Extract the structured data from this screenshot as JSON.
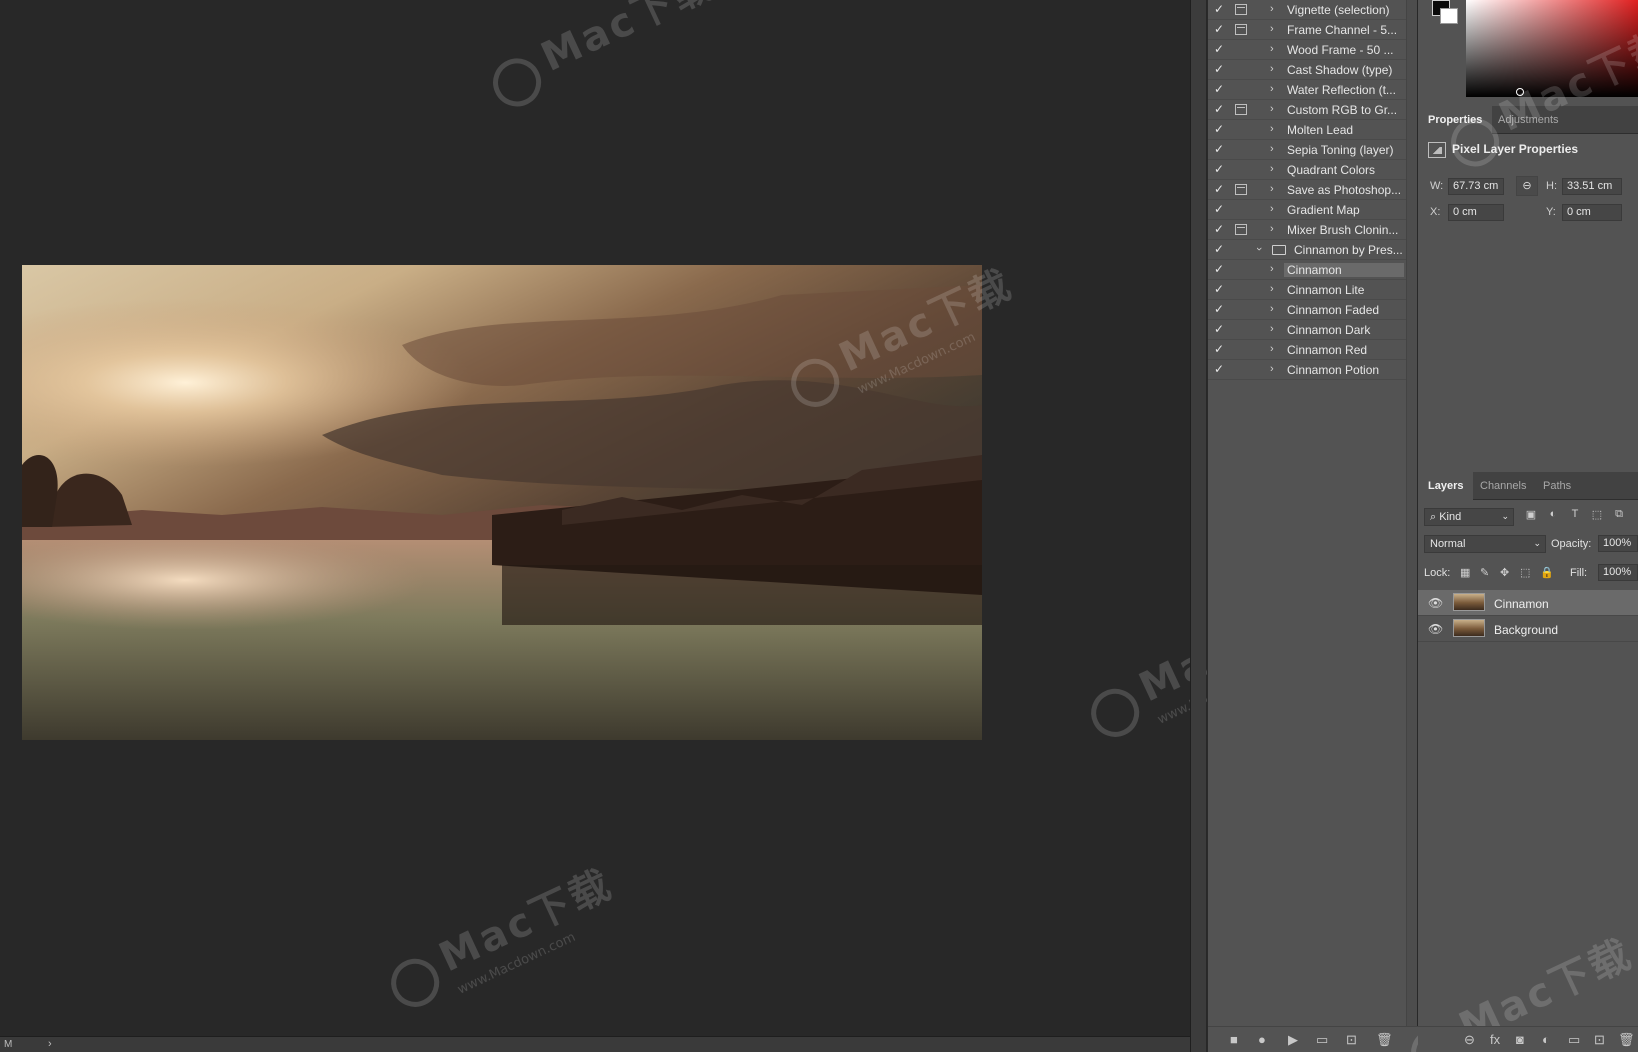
{
  "actions": [
    {
      "label": "Vignette (selection)",
      "dialog": true
    },
    {
      "label": "Frame Channel - 5...",
      "dialog": true
    },
    {
      "label": "Wood Frame - 50 ...",
      "dialog": false
    },
    {
      "label": "Cast Shadow (type)",
      "dialog": false
    },
    {
      "label": "Water Reflection (t...",
      "dialog": false
    },
    {
      "label": "Custom RGB to Gr...",
      "dialog": true
    },
    {
      "label": "Molten Lead",
      "dialog": false
    },
    {
      "label": "Sepia Toning (layer)",
      "dialog": false
    },
    {
      "label": "Quadrant Colors",
      "dialog": false
    },
    {
      "label": "Save as Photoshop...",
      "dialog": true
    },
    {
      "label": "Gradient Map",
      "dialog": false
    },
    {
      "label": "Mixer Brush Clonin...",
      "dialog": true
    }
  ],
  "action_set": {
    "label": "Cinnamon by Pres..."
  },
  "set_actions": [
    {
      "label": "Cinnamon",
      "selected": true
    },
    {
      "label": "Cinnamon Lite",
      "selected": false
    },
    {
      "label": "Cinnamon Faded",
      "selected": false
    },
    {
      "label": "Cinnamon Dark",
      "selected": false
    },
    {
      "label": "Cinnamon Red",
      "selected": false
    },
    {
      "label": "Cinnamon Potion",
      "selected": false
    }
  ],
  "check_glyph": "✓",
  "properties": {
    "tab_properties": "Properties",
    "tab_adjustments": "Adjustments",
    "title": "Pixel Layer Properties",
    "w_label": "W:",
    "w_value": "67.73 cm",
    "h_label": "H:",
    "h_value": "33.51 cm",
    "x_label": "X:",
    "x_value": "0 cm",
    "y_label": "Y:",
    "y_value": "0 cm"
  },
  "layers_panel": {
    "tab_layers": "Layers",
    "tab_channels": "Channels",
    "tab_paths": "Paths",
    "filter_kind": "Kind",
    "blend_mode": "Normal",
    "opacity_label": "Opacity:",
    "opacity_value": "100%",
    "lock_label": "Lock:",
    "fill_label": "Fill:",
    "fill_value": "100%",
    "layers": [
      {
        "name": "Cinnamon",
        "selected": true
      },
      {
        "name": "Background",
        "selected": false
      }
    ]
  },
  "status": {
    "text": "M"
  },
  "watermark": {
    "brand": "Mac下载",
    "url": "www.Macdown.com"
  },
  "colors": {
    "workspace": "#282828",
    "panel": "#535353",
    "selected_row": "#6a6a6a"
  }
}
